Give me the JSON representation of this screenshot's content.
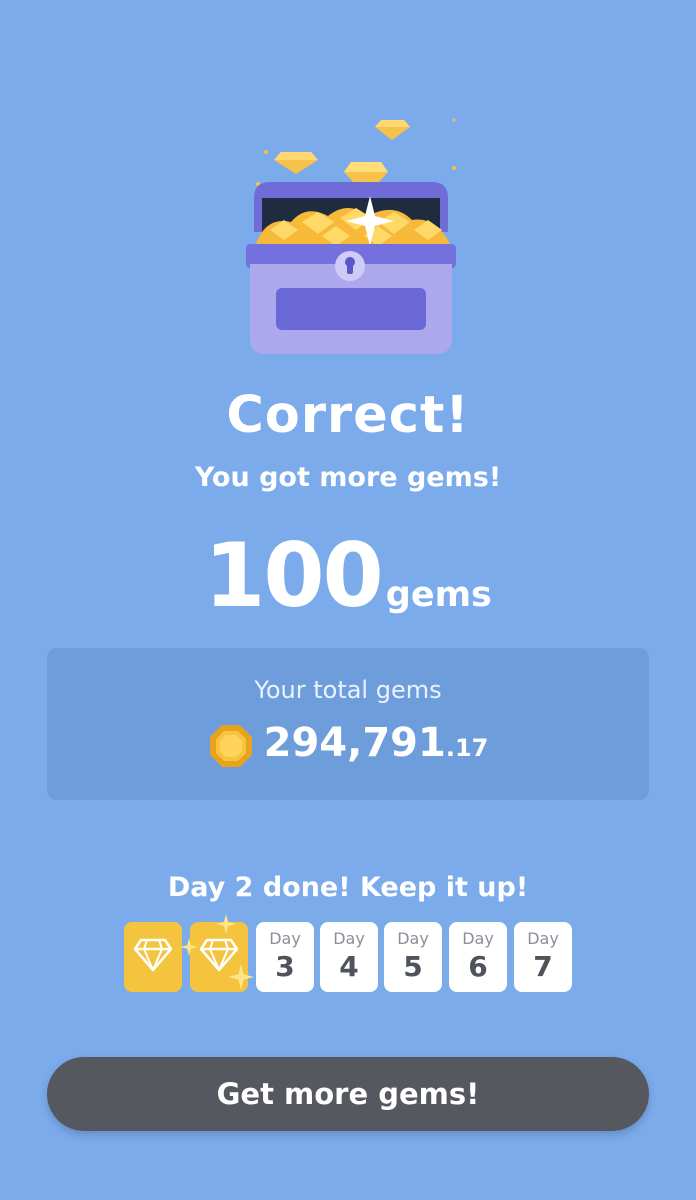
{
  "result": {
    "title": "Correct!",
    "subtitle": "You got more gems!"
  },
  "reward": {
    "amount": "100",
    "unit": "gems"
  },
  "total": {
    "label": "Your total gems",
    "integer": "294,791",
    "decimal": ".17"
  },
  "streak": {
    "message": "Day 2 done! Keep it up!",
    "completed_days": 2,
    "days": [
      {
        "label": "Day",
        "number": "3"
      },
      {
        "label": "Day",
        "number": "4"
      },
      {
        "label": "Day",
        "number": "5"
      },
      {
        "label": "Day",
        "number": "6"
      },
      {
        "label": "Day",
        "number": "7"
      }
    ]
  },
  "cta": {
    "label": "Get more gems!"
  },
  "icons": {
    "chest": "treasure-chest-icon",
    "total_gem": "gem-icon",
    "streak_done": "diamond-icon",
    "sparkle": "sparkle-icon"
  },
  "colors": {
    "background": "#7CABEB",
    "card": "#6E9DDC",
    "gold": "#F4C43E",
    "button": "#56585F",
    "chest_purple": "#8E8DE6"
  }
}
